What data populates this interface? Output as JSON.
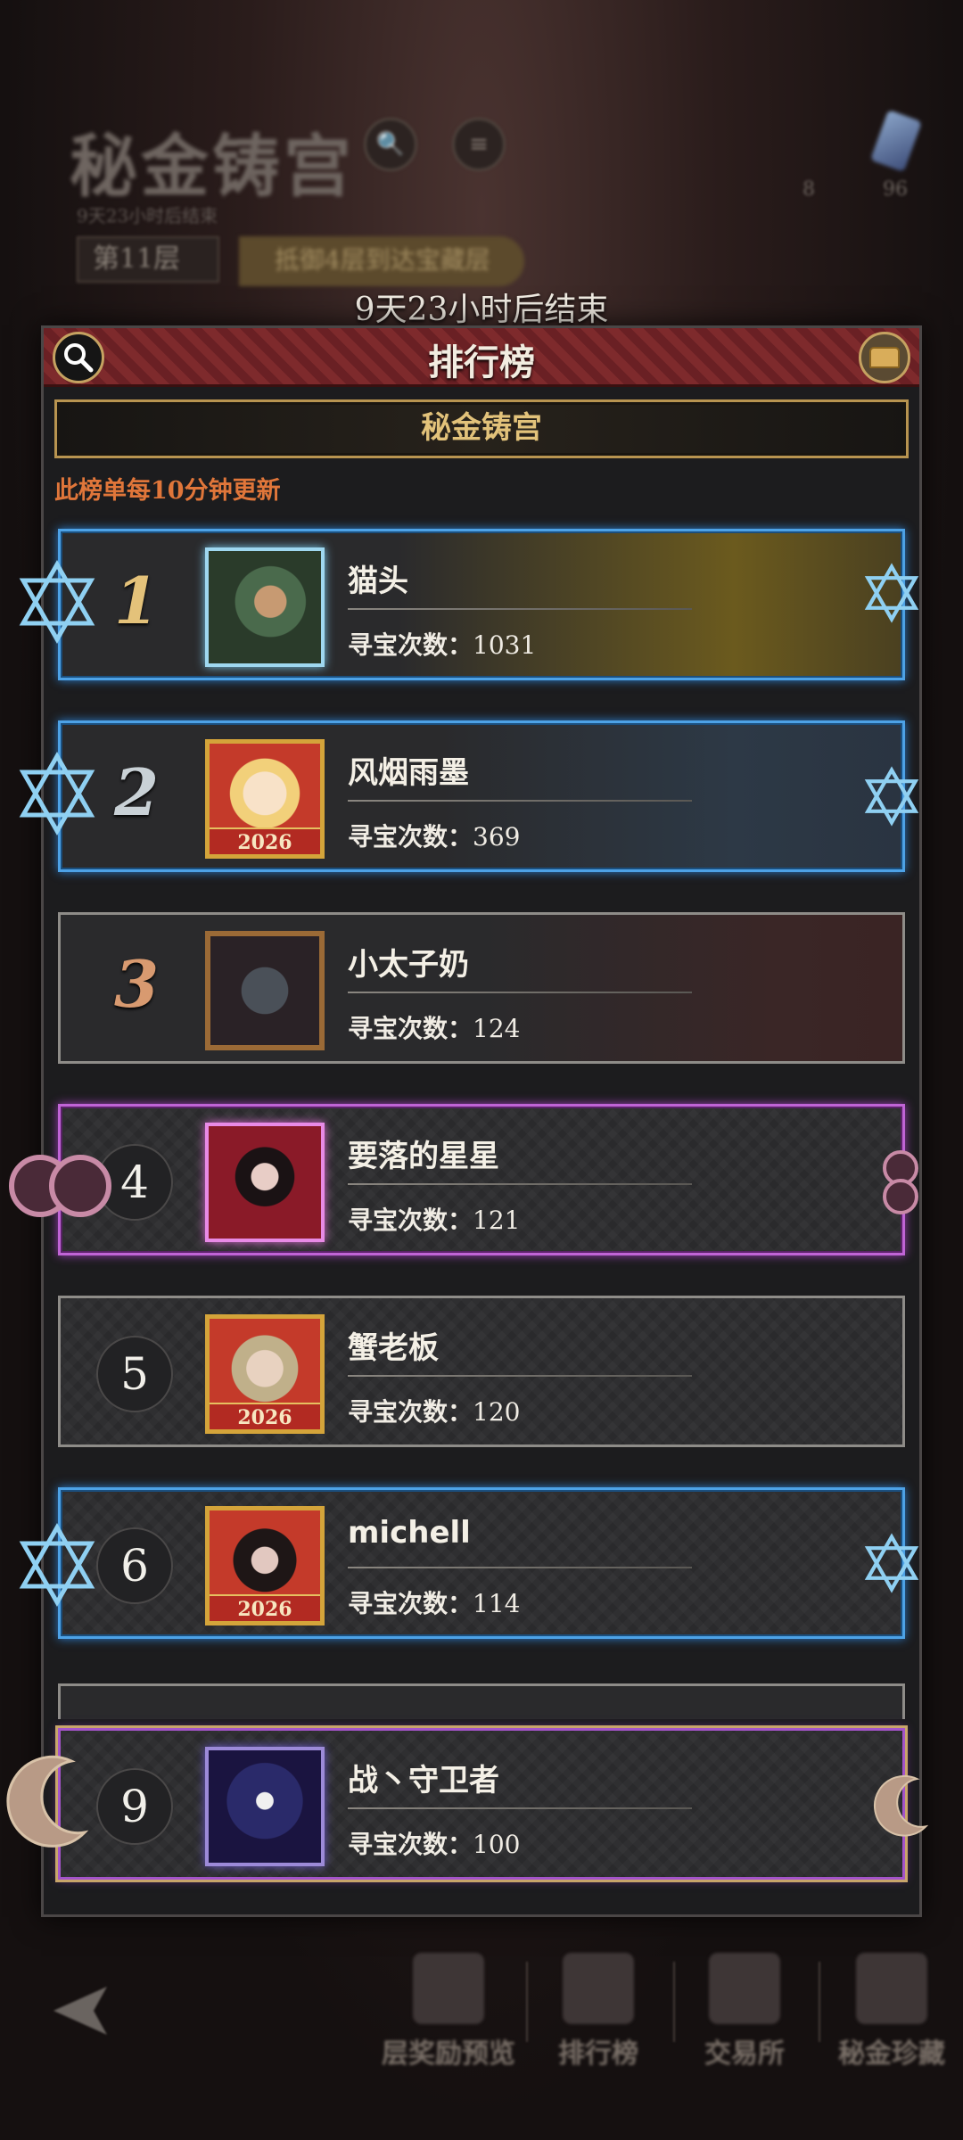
{
  "background": {
    "title": "秘金铸宫",
    "subtitle": "9天23小时后结束",
    "floor": "第11层",
    "banner": "抵御4层到达宝藏层",
    "num_left": "8",
    "num_right": "96"
  },
  "countdown": "9天23小时后结束",
  "panel": {
    "title": "排行榜",
    "subtitle": "秘金铸宫",
    "update_note": "此榜单每10分钟更新"
  },
  "count_label": "寻宝次数：",
  "rows": [
    {
      "rank": "1",
      "name": "猫头",
      "count": "1031"
    },
    {
      "rank": "2",
      "name": "风烟雨墨",
      "count": "369",
      "badge": "2026"
    },
    {
      "rank": "3",
      "name": "小太子奶",
      "count": "124"
    },
    {
      "rank": "4",
      "name": "要落的星星",
      "count": "121"
    },
    {
      "rank": "5",
      "name": "蟹老板",
      "count": "120",
      "badge": "2026"
    },
    {
      "rank": "6",
      "name": "michell",
      "count": "114",
      "badge": "2026"
    },
    {
      "rank": "9",
      "name": "战丶守卫者",
      "count": "100"
    }
  ],
  "bottom_nav": [
    {
      "label": "层奖励预览",
      "icon": "reward-icon"
    },
    {
      "label": "排行榜",
      "icon": "trophy-icon"
    },
    {
      "label": "交易所",
      "icon": "exchange-icon"
    },
    {
      "label": "秘金珍藏",
      "icon": "collection-icon"
    }
  ]
}
